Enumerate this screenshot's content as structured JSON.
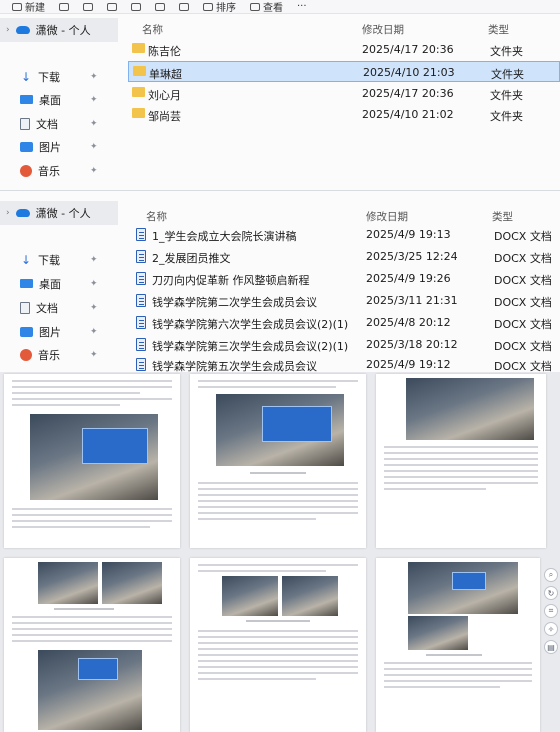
{
  "window1": {
    "toolbar": {
      "new_label": "新建",
      "sort_label": "排序",
      "view_label": "查看"
    },
    "sidebar": {
      "top_label": "潇微 - 个人",
      "items": [
        {
          "label": "下载",
          "icon": "download-icon"
        },
        {
          "label": "桌面",
          "icon": "desktop-icon"
        },
        {
          "label": "文档",
          "icon": "documents-icon"
        },
        {
          "label": "图片",
          "icon": "pictures-icon"
        },
        {
          "label": "音乐",
          "icon": "music-icon"
        }
      ]
    },
    "columns": {
      "name": "名称",
      "date": "修改日期",
      "type": "类型"
    },
    "files": [
      {
        "name": "陈吉伦",
        "date": "2025/4/17 20:36",
        "type": "文件夹"
      },
      {
        "name": "单琳超",
        "date": "2025/4/10 21:03",
        "type": "文件夹",
        "selected": true
      },
      {
        "name": "刘心月",
        "date": "2025/4/17 20:36",
        "type": "文件夹"
      },
      {
        "name": "邹尚芸",
        "date": "2025/4/10 21:02",
        "type": "文件夹"
      }
    ]
  },
  "window2": {
    "sidebar": {
      "top_label": "潇微 - 个人",
      "items": [
        {
          "label": "下载",
          "icon": "download-icon"
        },
        {
          "label": "桌面",
          "icon": "desktop-icon"
        },
        {
          "label": "文档",
          "icon": "documents-icon"
        },
        {
          "label": "图片",
          "icon": "pictures-icon"
        },
        {
          "label": "音乐",
          "icon": "music-icon"
        }
      ]
    },
    "columns": {
      "name": "名称",
      "date": "修改日期",
      "type": "类型"
    },
    "files": [
      {
        "name": "1_学生会成立大会院长演讲稿",
        "date": "2025/4/9 19:13",
        "type": "DOCX 文档"
      },
      {
        "name": "2_发展团员推文",
        "date": "2025/3/25 12:24",
        "type": "DOCX 文档"
      },
      {
        "name": "刀刃向内促革新 作风整顿启新程",
        "date": "2025/4/9 19:26",
        "type": "DOCX 文档"
      },
      {
        "name": "钱学森学院第二次学生会成员会议",
        "date": "2025/3/11 21:31",
        "type": "DOCX 文档"
      },
      {
        "name": "钱学森学院第六次学生会成员会议(2)(1)",
        "date": "2025/4/8 20:12",
        "type": "DOCX 文档"
      },
      {
        "name": "钱学森学院第三次学生会成员会议(2)(1)",
        "date": "2025/3/18 20:12",
        "type": "DOCX 文档"
      },
      {
        "name": "钱学森学院第五次学生会成员会议",
        "date": "2025/4/9 19:12",
        "type": "DOCX 文档"
      }
    ]
  },
  "viewer": {
    "tool_icons": [
      "zoom-icon",
      "rotate-icon",
      "crop-icon",
      "bulb-icon",
      "print-icon"
    ]
  }
}
